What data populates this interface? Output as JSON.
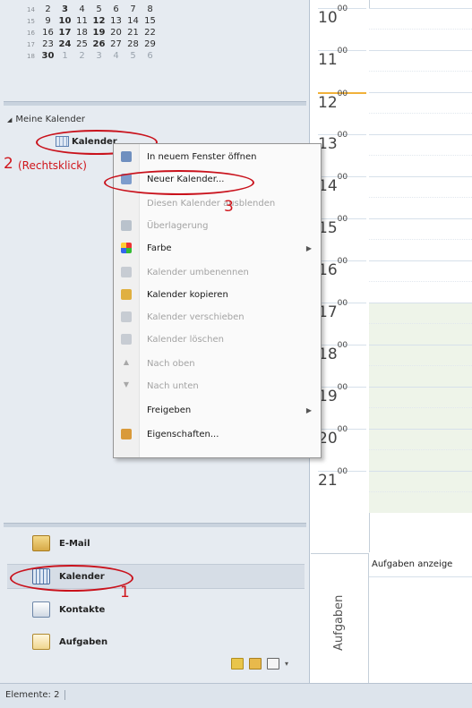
{
  "minical": {
    "weeks": [
      {
        "wn": "14",
        "days": [
          "2",
          "3",
          "4",
          "5",
          "6",
          "7",
          "8"
        ]
      },
      {
        "wn": "15",
        "days": [
          "9",
          "10",
          "11",
          "12",
          "13",
          "14",
          "15"
        ]
      },
      {
        "wn": "16",
        "days": [
          "16",
          "17",
          "18",
          "19",
          "20",
          "21",
          "22"
        ]
      },
      {
        "wn": "17",
        "days": [
          "23",
          "24",
          "25",
          "26",
          "27",
          "28",
          "29"
        ]
      },
      {
        "wn": "18",
        "days": [
          "30",
          "1",
          "2",
          "3",
          "4",
          "5",
          "6"
        ]
      }
    ]
  },
  "tree": {
    "group_label": "Meine Kalender",
    "item_label": "Kalender"
  },
  "annotations": {
    "step1": "1",
    "step2": "2",
    "step2_note": "(Rechtsklick)",
    "step3": "3"
  },
  "context_menu": {
    "items": [
      {
        "label": "In neuem Fenster öffnen",
        "disabled": false,
        "icon": "new-window-icon"
      },
      {
        "label": "Neuer Kalender...",
        "disabled": false,
        "icon": "new-calendar-icon"
      },
      {
        "label": "Diesen Kalender ausblenden",
        "disabled": true,
        "icon": ""
      },
      {
        "label": "Überlagerung",
        "disabled": true,
        "icon": "overlay-icon"
      },
      {
        "label": "Farbe",
        "disabled": false,
        "icon": "color-icon",
        "submenu": true
      },
      {
        "label": "Kalender umbenennen",
        "disabled": true,
        "icon": "rename-icon"
      },
      {
        "label": "Kalender kopieren",
        "disabled": false,
        "icon": "copy-icon"
      },
      {
        "label": "Kalender verschieben",
        "disabled": true,
        "icon": "move-icon"
      },
      {
        "label": "Kalender löschen",
        "disabled": true,
        "icon": "delete-icon"
      },
      {
        "label": "Nach oben",
        "disabled": true,
        "icon": "up-arrow-icon"
      },
      {
        "label": "Nach unten",
        "disabled": true,
        "icon": "down-arrow-icon"
      },
      {
        "label": "Freigeben",
        "disabled": false,
        "icon": "",
        "submenu": true
      },
      {
        "label": "Eigenschaften...",
        "disabled": false,
        "icon": "properties-icon"
      }
    ]
  },
  "day_view": {
    "hours": [
      "10",
      "11",
      "12",
      "13",
      "14",
      "15",
      "16",
      "17",
      "18",
      "19",
      "20",
      "21"
    ],
    "minutes": "00",
    "tasks_header": "Aufgaben anzeige",
    "tasks_side_label": "Aufgaben"
  },
  "nav_buttons": {
    "mail": "E-Mail",
    "calendar": "Kalender",
    "contacts": "Kontakte",
    "tasks": "Aufgaben"
  },
  "status": {
    "items_label": "Elemente: 2"
  },
  "colors": {
    "annotation_red": "#d0151b",
    "nav_bg": "#e6ebf1",
    "busy_green": "#eef4e9",
    "now_line": "#f1b13a"
  }
}
